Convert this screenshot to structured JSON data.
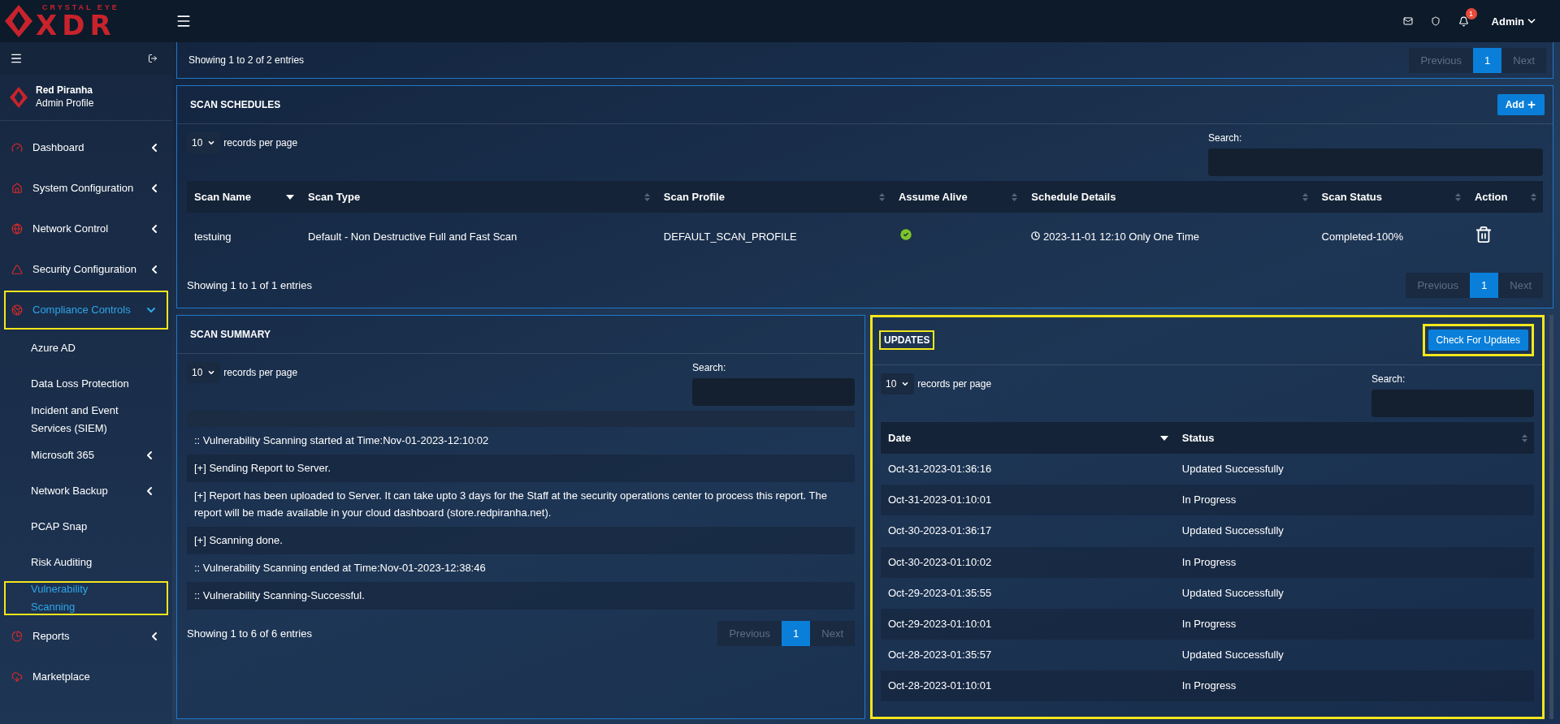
{
  "brand": {
    "tagline": "CRYSTAL EYE",
    "name": "XDR"
  },
  "profile": {
    "name": "Red Piranha",
    "role": "Admin Profile"
  },
  "header": {
    "notifications": "1",
    "user": "Admin"
  },
  "sidebar": {
    "items": [
      {
        "label": "Dashboard",
        "expanded": false,
        "selected": false,
        "highlighted": false
      },
      {
        "label": "System Configuration",
        "expanded": false,
        "selected": false,
        "highlighted": false
      },
      {
        "label": "Network Control",
        "expanded": false,
        "selected": false,
        "highlighted": false
      },
      {
        "label": "Security Configuration",
        "expanded": false,
        "selected": false,
        "highlighted": false
      },
      {
        "label": "Compliance Controls",
        "expanded": true,
        "selected": true,
        "highlighted": true,
        "children": [
          {
            "label": "Azure AD",
            "expandable": false,
            "selected": false,
            "highlighted": false
          },
          {
            "label": "Data Loss Protection",
            "expandable": false,
            "selected": false,
            "highlighted": false
          },
          {
            "label": "Incident and Event Services (SIEM)",
            "expandable": false,
            "selected": false,
            "highlighted": false
          },
          {
            "label": "Microsoft 365",
            "expandable": true,
            "selected": false,
            "highlighted": false
          },
          {
            "label": "Network Backup",
            "expandable": true,
            "selected": false,
            "highlighted": false
          },
          {
            "label": "PCAP Snap",
            "expandable": false,
            "selected": false,
            "highlighted": false
          },
          {
            "label": "Risk Auditing",
            "expandable": false,
            "selected": false,
            "highlighted": false
          },
          {
            "label": "Vulnerability Scanning",
            "expandable": false,
            "selected": true,
            "highlighted": true
          }
        ]
      },
      {
        "label": "Reports",
        "expanded": false,
        "selected": false,
        "highlighted": false
      },
      {
        "label": "Marketplace",
        "selected": false,
        "highlighted": false
      }
    ]
  },
  "top_panel": {
    "info": "Showing 1 to 2 of 2 entries",
    "pagination": [
      {
        "label": "Previous",
        "selected": false,
        "disabled": true
      },
      {
        "label": "1",
        "selected": true,
        "disabled": false
      },
      {
        "label": "Next",
        "selected": false,
        "disabled": true
      }
    ]
  },
  "scan_schedules": {
    "title": "SCAN SCHEDULES",
    "add_button": "Add",
    "page_size": "10",
    "page_size_label": "records per page",
    "search_label": "Search:",
    "columns": [
      {
        "label": "Scan Name",
        "sorted": true
      },
      {
        "label": "Scan Type",
        "sorted": false
      },
      {
        "label": "Scan Profile",
        "sorted": false
      },
      {
        "label": "Assume Alive",
        "sorted": false
      },
      {
        "label": "Schedule Details",
        "sorted": false
      },
      {
        "label": "Scan Status",
        "sorted": false
      },
      {
        "label": "Action",
        "sorted": false
      }
    ],
    "rows": [
      {
        "scan_name": "testuing",
        "scan_type": "Default - Non Destructive Full and Fast Scan",
        "scan_profile": "DEFAULT_SCAN_PROFILE",
        "assume_alive": true,
        "schedule": "2023-11-01 12:10 Only One Time",
        "status": "Completed-100%"
      }
    ],
    "info": "Showing 1 to 1 of 1 entries",
    "pagination": [
      {
        "label": "Previous",
        "selected": false,
        "disabled": true
      },
      {
        "label": "1",
        "selected": true,
        "disabled": false
      },
      {
        "label": "Next",
        "selected": false,
        "disabled": true
      }
    ]
  },
  "scan_summary": {
    "title": "SCAN SUMMARY",
    "page_size": "10",
    "page_size_label": "records per page",
    "search_label": "Search:",
    "rows": [
      ":: Vulnerability Scanning started at Time:Nov-01-2023-12:10:02",
      "[+] Sending Report to Server.",
      "[+] Report has been uploaded to Server. It can take upto 3 days for the Staff at the security operations center to process this report. The report will be made available in your cloud dashboard (store.redpiranha.net).",
      "[+] Scanning done.",
      ":: Vulnerability Scanning ended at Time:Nov-01-2023-12:38:46",
      ":: Vulnerability Scanning-Successful."
    ],
    "info": "Showing 1 to 6 of 6 entries",
    "pagination": [
      {
        "label": "Previous",
        "selected": false,
        "disabled": true
      },
      {
        "label": "1",
        "selected": true,
        "disabled": false
      },
      {
        "label": "Next",
        "selected": false,
        "disabled": true
      }
    ]
  },
  "updates": {
    "title": "UPDATES",
    "title_highlighted": true,
    "button": "Check For Updates",
    "button_highlighted": true,
    "highlighted": true,
    "page_size": "10",
    "page_size_label": "records per page",
    "search_label": "Search:",
    "columns": [
      {
        "label": "Date",
        "sorted": true
      },
      {
        "label": "Status",
        "sorted": false
      }
    ],
    "rows": [
      {
        "date": "Oct-31-2023-01:36:16",
        "status": "Updated Successfully"
      },
      {
        "date": "Oct-31-2023-01:10:01",
        "status": "In Progress"
      },
      {
        "date": "Oct-30-2023-01:36:17",
        "status": "Updated Successfully"
      },
      {
        "date": "Oct-30-2023-01:10:02",
        "status": "In Progress"
      },
      {
        "date": "Oct-29-2023-01:35:55",
        "status": "Updated Successfully"
      },
      {
        "date": "Oct-29-2023-01:10:01",
        "status": "In Progress"
      },
      {
        "date": "Oct-28-2023-01:35:57",
        "status": "Updated Successfully"
      },
      {
        "date": "Oct-28-2023-01:10:01",
        "status": "In Progress"
      }
    ]
  }
}
